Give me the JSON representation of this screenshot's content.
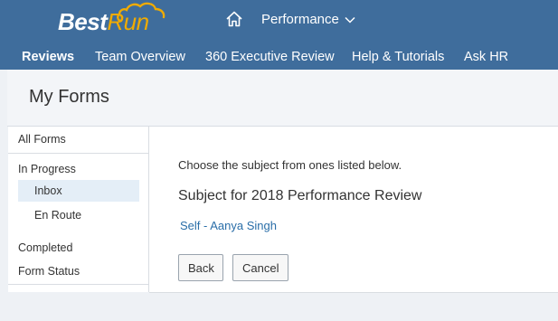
{
  "header": {
    "logo_main": "Best",
    "logo_accent": "Run",
    "module_label": "Performance",
    "colors": {
      "bar": "#3f6d9c",
      "logo_accent": "#f0ab00"
    }
  },
  "nav": {
    "items": [
      {
        "label": "Reviews",
        "active": true
      },
      {
        "label": "Team Overview",
        "active": false
      },
      {
        "label": "360 Executive Review",
        "active": false
      },
      {
        "label": "Help & Tutorials",
        "active": false
      },
      {
        "label": "Ask HR",
        "active": false
      }
    ]
  },
  "page": {
    "title": "My Forms"
  },
  "sidebar": {
    "all_forms": "All Forms",
    "in_progress": "In Progress",
    "inbox": "Inbox",
    "en_route": "En Route",
    "completed": "Completed",
    "form_status": "Form Status",
    "selected": "Inbox"
  },
  "main": {
    "instruction": "Choose the subject from ones listed below.",
    "subject_title": "Subject for 2018 Performance Review",
    "self_link": "Self - Aanya Singh",
    "back_label": "Back",
    "cancel_label": "Cancel"
  },
  "icons": {
    "home": "home-icon",
    "dropdown": "chevron-down-icon"
  }
}
